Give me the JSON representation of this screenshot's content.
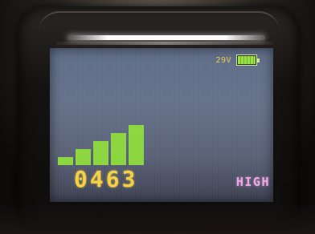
{
  "status": {
    "voltage": "29V",
    "battery_level": 1.0
  },
  "meter": {
    "bars_lit": 5,
    "bars_total": 5
  },
  "count": "0463",
  "level": "HIGH",
  "colors": {
    "screen": "#5f6d88",
    "count": "#f4d044",
    "level": "#f0a6e4",
    "voltage": "#e8c84a",
    "bar": "#8fdc3e",
    "battery": "#9ee04a"
  },
  "icons": {
    "battery": "battery-full-icon",
    "signal": "signal-bars-icon"
  }
}
